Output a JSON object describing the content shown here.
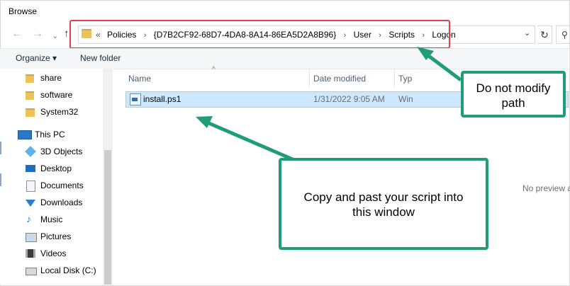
{
  "window": {
    "title": "Browse"
  },
  "nav": {
    "back": "←",
    "forward": "→",
    "down": "⌄",
    "up": "↑"
  },
  "address": {
    "lead": "«",
    "crumbs": [
      "Policies",
      "{D7B2CF92-68D7-4DA8-8A14-86EA5D2A8B96}",
      "User",
      "Scripts",
      "Logon"
    ],
    "separator": "›",
    "dropdown": "⌄",
    "refresh": "↻",
    "search_icon": "⚲"
  },
  "toolbar": {
    "organize": "Organize ▾",
    "new_folder": "New folder"
  },
  "sidebar": {
    "items": [
      {
        "label": "share",
        "icon": "folder-icon",
        "pinned": true
      },
      {
        "label": "software",
        "icon": "folder-icon",
        "pinned": true
      },
      {
        "label": "System32",
        "icon": "folder-icon",
        "pinned": false
      },
      {
        "label": "This PC",
        "icon": "computer-icon"
      },
      {
        "label": "3D Objects",
        "icon": "cube-icon"
      },
      {
        "label": "Desktop",
        "icon": "desktop-icon"
      },
      {
        "label": "Documents",
        "icon": "documents-icon"
      },
      {
        "label": "Downloads",
        "icon": "download-icon"
      },
      {
        "label": "Music",
        "icon": "music-icon"
      },
      {
        "label": "Pictures",
        "icon": "pictures-icon"
      },
      {
        "label": "Videos",
        "icon": "videos-icon"
      },
      {
        "label": "Local Disk (C:)",
        "icon": "disk-icon"
      }
    ]
  },
  "filelist": {
    "columns": {
      "name": "Name",
      "date": "Date modified",
      "type": "Typ"
    },
    "rows": [
      {
        "name": "install.ps1",
        "date": "1/31/2022 9:05 AM",
        "type": "Win"
      }
    ]
  },
  "preview": {
    "empty_text": "No preview a"
  },
  "annotations": {
    "path_note_line1": "Do not modify",
    "path_note_line2": "path",
    "script_note_line1": "Copy and past your script into",
    "script_note_line2": "this window",
    "callout_color": "#1f9d78",
    "highlight_color": "#e0424a"
  }
}
